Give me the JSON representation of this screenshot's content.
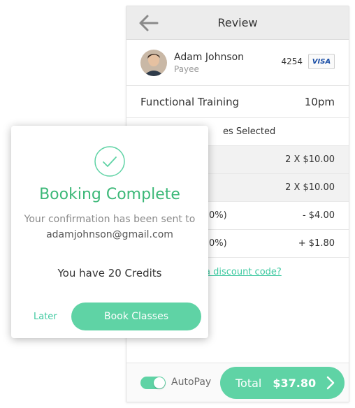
{
  "header": {
    "title": "Review"
  },
  "payee": {
    "name": "Adam Johnson",
    "role": "Payee",
    "card_last4": "4254",
    "card_brand": "VISA"
  },
  "booking": {
    "class_name": "Functional Training",
    "time": "10pm"
  },
  "details": {
    "selected_label": "es Selected",
    "lines": [
      {
        "label": "",
        "value": "2 X   $10.00"
      },
      {
        "label": "",
        "value": "2 X   $10.00"
      },
      {
        "label": "0%)",
        "value": "- $4.00"
      },
      {
        "label": "0%)",
        "value": "+ $1.80"
      }
    ],
    "discount_link": "a discount code?"
  },
  "footer": {
    "autopay_label": "AutoPay",
    "autopay_on": true,
    "total_label": "Total",
    "total_value": "$37.80"
  },
  "modal": {
    "title": "Booking Complete",
    "subtitle": "Your confirmation has been sent to",
    "email": "adamjohnson@gmail.com",
    "credits": "You have 20 Credits",
    "later_label": "Later",
    "book_label": "Book Classes"
  },
  "colors": {
    "accent": "#5fd3a5",
    "title_green": "#3cb878",
    "header_bg": "#ececec"
  },
  "icons": {
    "back": "arrow-left-icon",
    "check": "check-circle-icon",
    "chevron": "chevron-right-icon"
  }
}
